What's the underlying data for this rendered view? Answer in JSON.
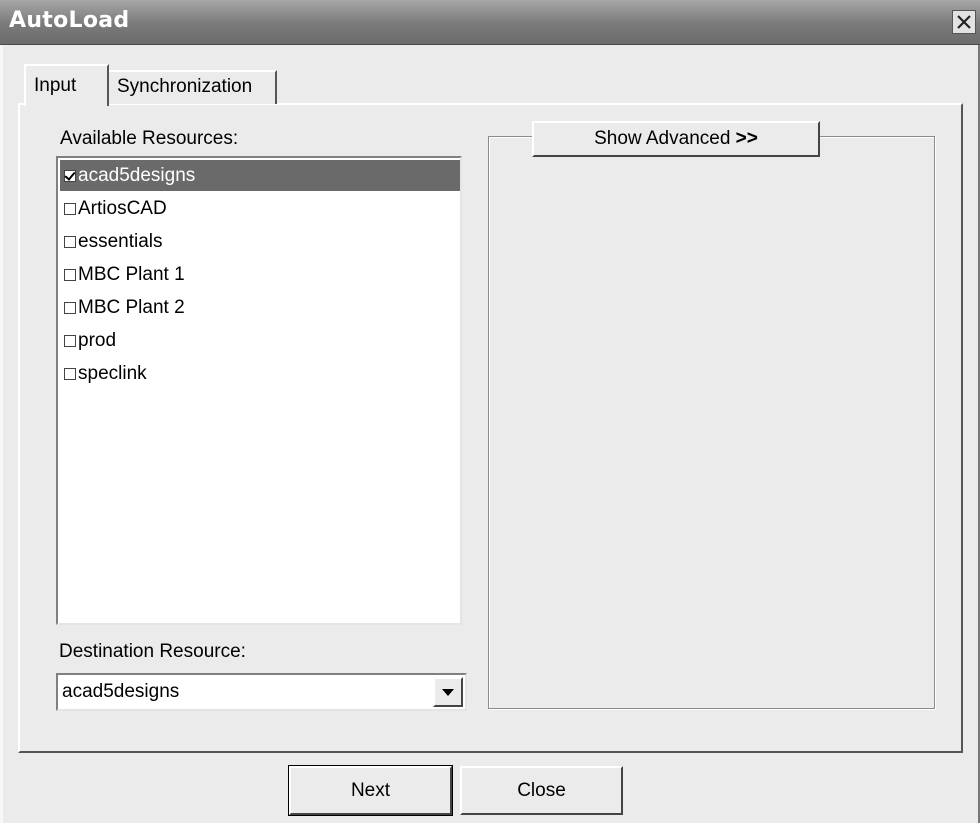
{
  "window": {
    "title": "AutoLoad"
  },
  "tabs": [
    {
      "label": "Input",
      "active": true
    },
    {
      "label": "Synchronization",
      "active": false
    }
  ],
  "available_resources": {
    "label": "Available Resources:",
    "items": [
      {
        "label": "acad5designs",
        "checked": true,
        "selected": true
      },
      {
        "label": "ArtiosCAD",
        "checked": false,
        "selected": false
      },
      {
        "label": "essentials",
        "checked": false,
        "selected": false
      },
      {
        "label": "MBC Plant 1",
        "checked": false,
        "selected": false
      },
      {
        "label": "MBC Plant 2",
        "checked": false,
        "selected": false
      },
      {
        "label": "prod",
        "checked": false,
        "selected": false
      },
      {
        "label": "speclink",
        "checked": false,
        "selected": false
      }
    ]
  },
  "destination": {
    "label": "Destination Resource:",
    "value": "acad5designs"
  },
  "advanced": {
    "label": "Show Advanced",
    "suffix": ">>"
  },
  "buttons": {
    "next": "Next",
    "close": "Close"
  },
  "colors": {
    "selection": "#6a6a6a",
    "dialog_bg": "#ebebeb",
    "title_bar": "#7a7a7a"
  }
}
